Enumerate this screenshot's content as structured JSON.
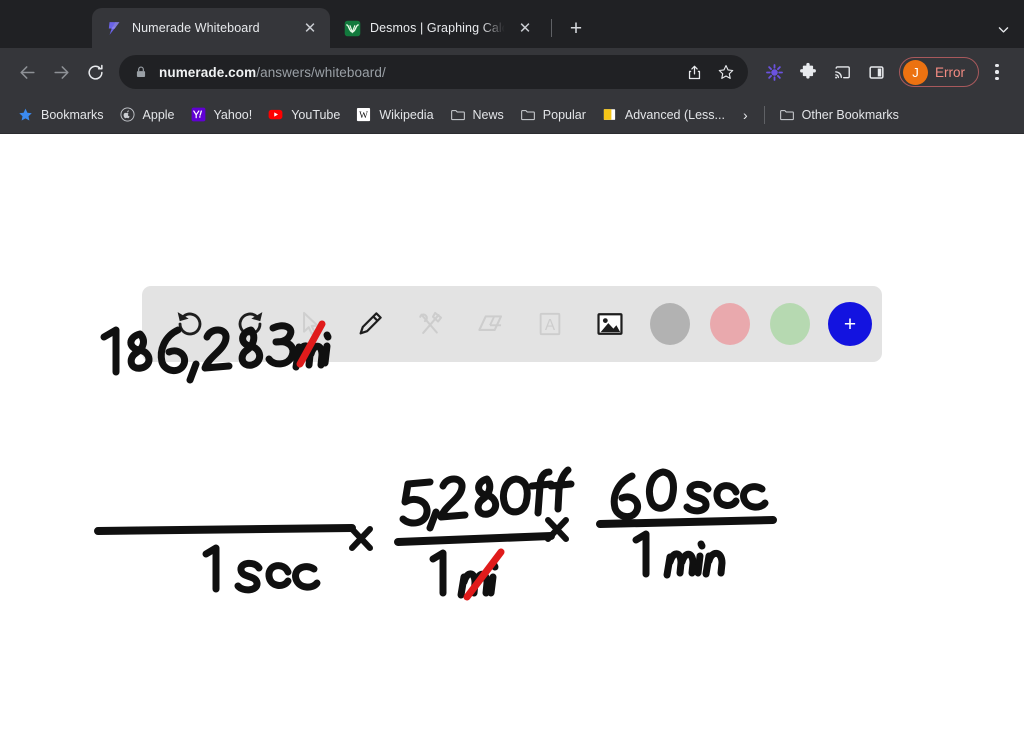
{
  "browser": {
    "tabs": [
      {
        "title": "Numerade Whiteboard",
        "favicon": "numerade-icon",
        "active": true,
        "close": "✕"
      },
      {
        "title": "Desmos | Graphing Calculator",
        "favicon": "desmos-icon",
        "active": false,
        "close": "✕"
      }
    ],
    "new_tab_label": "+",
    "tab_search_label": "⌄",
    "nav": {
      "back": "back-arrow-icon",
      "forward": "forward-arrow-icon",
      "reload": "reload-icon"
    },
    "omnibox": {
      "lock": "lock-icon",
      "host": "numerade.com",
      "path": "/answers/whiteboard/",
      "share": "share-icon",
      "bookmark": "star-icon"
    },
    "extensions": [
      {
        "name": "extension-purple-icon"
      },
      {
        "name": "extensions-puzzle-icon"
      },
      {
        "name": "cast-icon"
      },
      {
        "name": "side-panel-icon"
      }
    ],
    "profile": {
      "initial": "J",
      "label": "Error"
    },
    "menu": "kebab-menu-icon",
    "bookmarks": [
      {
        "label": "Bookmarks",
        "icon": "blue-star-icon"
      },
      {
        "label": "Apple",
        "icon": "apple-icon"
      },
      {
        "label": "Yahoo!",
        "icon": "yahoo-icon"
      },
      {
        "label": "YouTube",
        "icon": "youtube-icon"
      },
      {
        "label": "Wikipedia",
        "icon": "wikipedia-icon"
      },
      {
        "label": "News",
        "icon": "folder-icon"
      },
      {
        "label": "Popular",
        "icon": "folder-icon"
      },
      {
        "label": "Advanced (Less...",
        "icon": "yellow-folder-icon"
      }
    ],
    "bookmarks_overflow": "›",
    "other_bookmarks": {
      "label": "Other Bookmarks",
      "icon": "folder-icon"
    }
  },
  "whiteboard": {
    "toolbar": {
      "tools": [
        {
          "name": "undo-icon",
          "enabled": true
        },
        {
          "name": "redo-icon",
          "enabled": true
        },
        {
          "name": "cursor-icon",
          "enabled": false
        },
        {
          "name": "pencil-icon",
          "enabled": true
        },
        {
          "name": "shapes-tools-icon",
          "enabled": false
        },
        {
          "name": "eraser-icon",
          "enabled": false
        },
        {
          "name": "text-icon",
          "enabled": false
        },
        {
          "name": "image-icon",
          "enabled": true
        }
      ],
      "swatches": [
        {
          "name": "color-gray",
          "color": "#b2b2b2"
        },
        {
          "name": "color-pink",
          "color": "#e9a9ad"
        },
        {
          "name": "color-green",
          "color": "#b6d9b1"
        }
      ],
      "add_button": {
        "label": "+",
        "color": "#1313e0"
      }
    },
    "ink": {
      "color": "#101010",
      "strike_color": "#e01b1b",
      "expression": "186,283 mi / 1 sec × 5,280 ft / 1 mi × 60 sec / 1 min",
      "terms": [
        {
          "numerator": "186,283 mi",
          "denominator": "1 sec",
          "struck": "mi"
        },
        {
          "operator": "×"
        },
        {
          "numerator": "5,280 ft",
          "denominator": "1 mi",
          "struck": "mi"
        },
        {
          "operator": "×"
        },
        {
          "numerator": "60 sec",
          "denominator": "1 min",
          "struck": ""
        }
      ]
    }
  }
}
